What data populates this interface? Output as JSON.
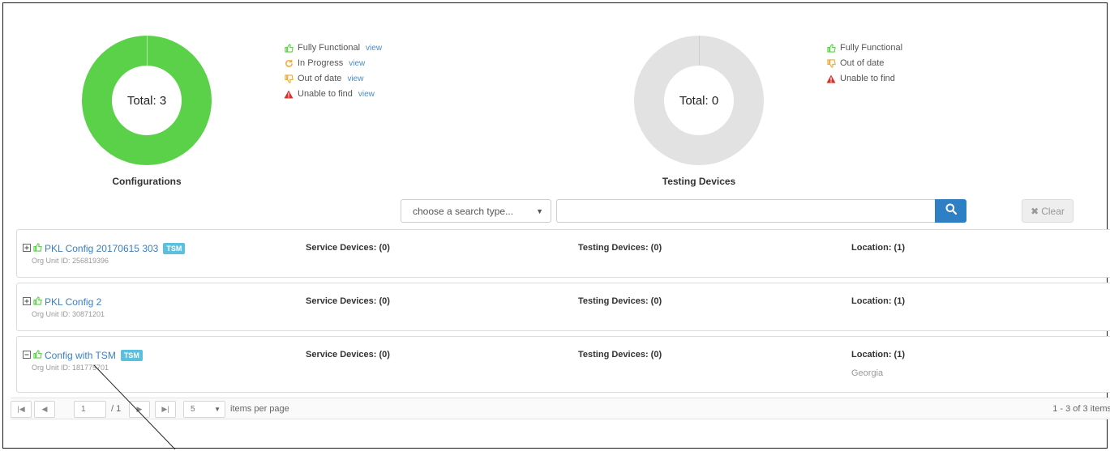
{
  "colors": {
    "accent": "#2e7fc4",
    "functional_green": "#5bd14a",
    "link_blue": "#3a7fbf",
    "badge": "#5bc0de",
    "empty_gray": "#e2e2e2",
    "warning_red": "#d9302b",
    "in_progress_orange": "#f0a830"
  },
  "configurations_chart": {
    "total_label": "Total: 3",
    "caption": "Configurations"
  },
  "configurations_legend": [
    {
      "label": "Fully Functional",
      "view": "view",
      "icon": "thumbs-up-icon"
    },
    {
      "label": "In Progress",
      "view": "view",
      "icon": "refresh-icon"
    },
    {
      "label": "Out of date",
      "view": "view",
      "icon": "thumbs-down-icon"
    },
    {
      "label": "Unable to find",
      "view": "view",
      "icon": "warning-icon"
    }
  ],
  "devices_chart": {
    "total_label": "Total: 0",
    "caption": "Testing Devices"
  },
  "devices_legend": [
    {
      "label": "Fully Functional",
      "icon": "thumbs-up-icon"
    },
    {
      "label": "Out of date",
      "icon": "thumbs-down-icon"
    },
    {
      "label": "Unable to find",
      "icon": "warning-icon"
    }
  ],
  "search": {
    "type_selected": "choose a search type...",
    "query": "",
    "clear_label": "Clear"
  },
  "rows": [
    {
      "name": "PKL Config 20170615 303",
      "badge": "TSM",
      "org_unit": "Org Unit ID: 256819396",
      "service": "Service Devices: (0)",
      "testing": "Testing Devices: (0)",
      "location": "Location: (1)",
      "location_detail": ""
    },
    {
      "name": "PKL Config 2",
      "badge": "",
      "org_unit": "Org Unit ID: 30871201",
      "service": "Service Devices: (0)",
      "testing": "Testing Devices: (0)",
      "location": "Location: (1)",
      "location_detail": ""
    },
    {
      "name": "Config with TSM",
      "badge": "TSM",
      "org_unit": "Org Unit ID: 181775701",
      "service": "Service Devices: (0)",
      "testing": "Testing Devices: (0)",
      "location": "Location: (1)",
      "location_detail": "Georgia"
    }
  ],
  "pager": {
    "page": "1",
    "page_of": "/ 1",
    "page_size": "5",
    "items_per_page": "items per page",
    "summary": "1 - 3 of 3 items"
  }
}
